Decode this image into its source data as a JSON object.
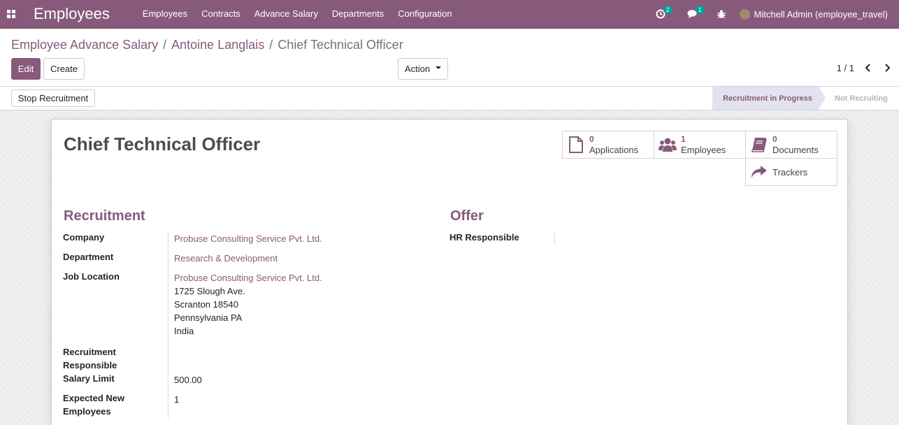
{
  "navbar": {
    "app_title": "Employees",
    "menu": [
      "Employees",
      "Contracts",
      "Advance Salary",
      "Departments",
      "Configuration"
    ],
    "activity_count": "2",
    "message_count": "1",
    "user_name": "Mitchell Admin (employee_travel)"
  },
  "breadcrumb": {
    "root": "Employee Advance Salary",
    "sep1": "/",
    "parent": "Antoine Langlais",
    "sep2": "/",
    "current": "Chief Technical Officer"
  },
  "buttons": {
    "edit": "Edit",
    "create": "Create",
    "action": "Action",
    "stop_recruitment": "Stop Recruitment"
  },
  "pager": {
    "value": "1 / 1"
  },
  "status": {
    "active": "Recruitment in Progress",
    "next": "Not Recruiting"
  },
  "record": {
    "title": "Chief Technical Officer"
  },
  "smart_buttons": [
    {
      "count": "0",
      "label": "Applications",
      "icon": "file-icon"
    },
    {
      "count": "1",
      "label": "Employees",
      "icon": "users-icon"
    },
    {
      "count": "0",
      "label": "Documents",
      "icon": "book-icon"
    },
    {
      "count": "",
      "label": "Trackers",
      "icon": "share-icon"
    }
  ],
  "recruitment": {
    "heading": "Recruitment",
    "company_label": "Company",
    "company_value": "Probuse Consulting Service Pvt. Ltd.",
    "department_label": "Department",
    "department_value": "Research & Development",
    "location_label": "Job Location",
    "location_name": "Probuse Consulting Service Pvt. Ltd.",
    "location_street": "1725 Slough Ave.",
    "location_city": "Scranton 18540",
    "location_state": "Pennsylvania PA",
    "location_country": "India",
    "responsible_label_1": "Recruitment",
    "responsible_label_2": "Responsible",
    "salary_label": "Salary Limit",
    "salary_value": "500.00",
    "expected_label_1": "Expected New",
    "expected_label_2": "Employees",
    "expected_value": "1"
  },
  "offer": {
    "heading": "Offer",
    "hr_label": "HR Responsible",
    "hr_value": ""
  }
}
